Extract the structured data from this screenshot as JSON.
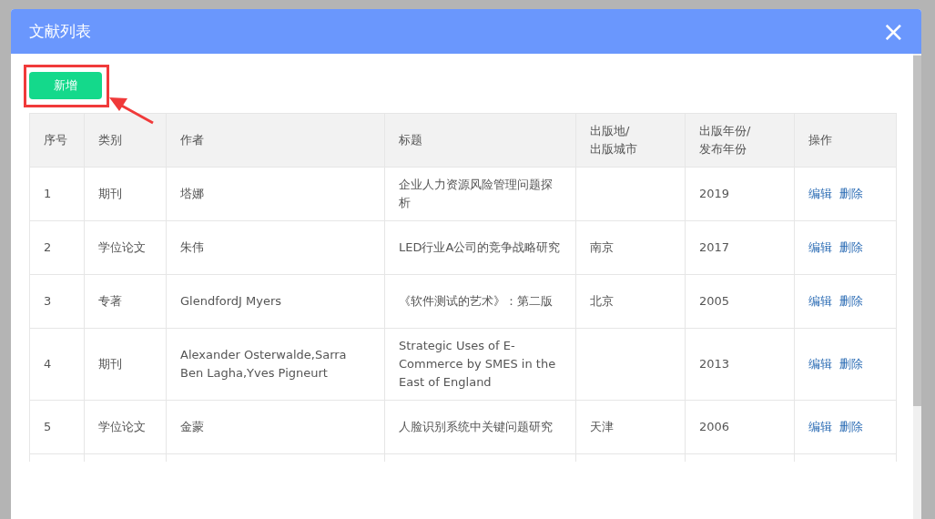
{
  "dialog": {
    "title": "文献列表",
    "close_label": "×"
  },
  "add_button": "新增",
  "table": {
    "columns": [
      "序号",
      "类别",
      "作者",
      "标题",
      "出版地/\n出版城市",
      "出版年份/\n发布年份",
      "操作"
    ],
    "rows": [
      {
        "cells": [
          "1",
          "期刊",
          "塔娜",
          "企业人力资源风险管理问题探析",
          "",
          "2019"
        ],
        "actions": [
          "编辑",
          "删除"
        ]
      },
      {
        "cells": [
          "2",
          "学位论文",
          "朱伟",
          "LED行业A公司的竞争战略研究",
          "南京",
          "2017"
        ],
        "actions": [
          "编辑",
          "删除"
        ]
      },
      {
        "cells": [
          "3",
          "专著",
          "GlendfordJ Myers",
          "《软件测试的艺术》：第二版",
          "北京",
          "2005"
        ],
        "actions": [
          "编辑",
          "删除"
        ]
      },
      {
        "cells": [
          "4",
          "期刊",
          "Alexander Osterwalde,Sarra Ben Lagha,Yves Pigneurt",
          "Strategic Uses of E-Commerce by SMES in the East of England",
          "",
          "2013"
        ],
        "actions": [
          "编辑",
          "删除"
        ]
      },
      {
        "cells": [
          "5",
          "学位论文",
          "金蒙",
          "人脸识别系统中关键问题研究",
          "天津",
          "2006"
        ],
        "actions": [
          "编辑",
          "删除"
        ]
      }
    ]
  }
}
